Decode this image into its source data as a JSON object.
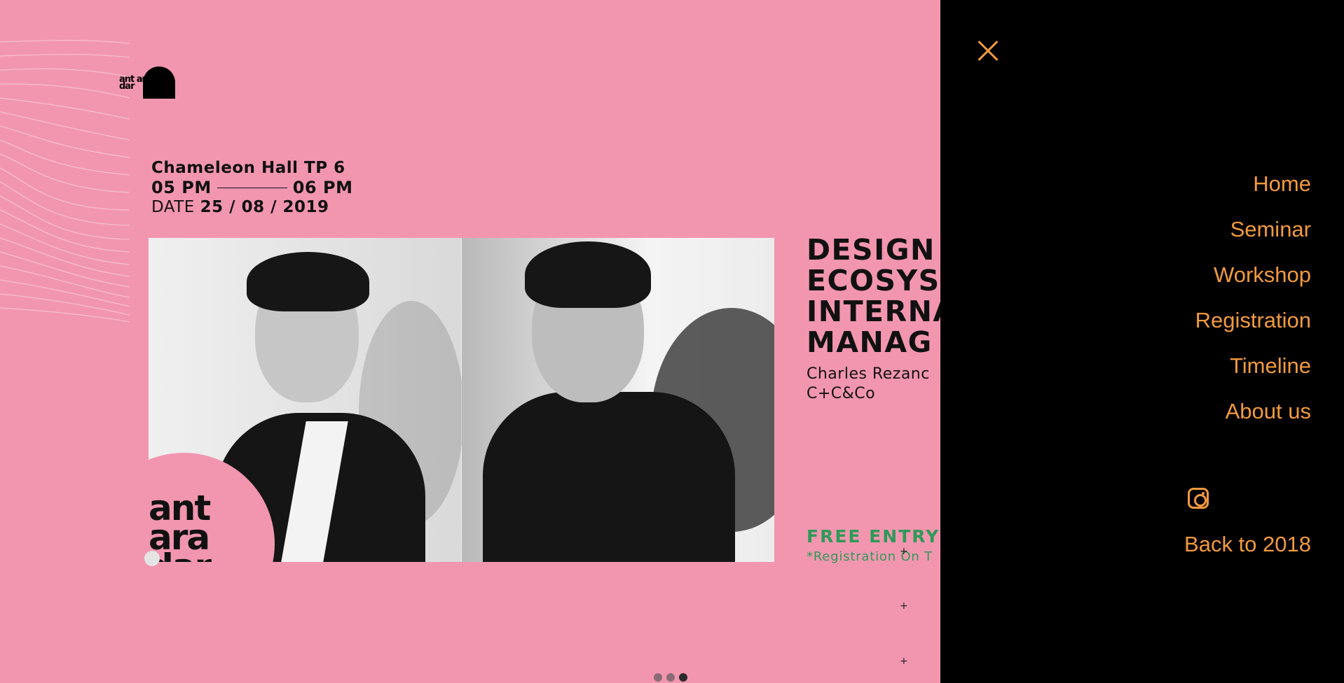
{
  "logo": {
    "text": "ant ara dar"
  },
  "event": {
    "venue": "Chameleon Hall TP 6",
    "start_time": "05 PM",
    "end_time": "06 PM",
    "date_label": "DATE",
    "date_value": "25 / 08 / 2019"
  },
  "seminar": {
    "title": "DESIGN\nECOSYS\nINTERNA\nMANAG",
    "speaker_name": "Charles Rezanc",
    "speaker_company": "C+C&Co",
    "free_entry": "FREE ENTRY",
    "registration_note": "*Registration On T"
  },
  "photo_badge": {
    "text": "ant\nara\ndar"
  },
  "menu": {
    "items": [
      {
        "label": "Home"
      },
      {
        "label": "Seminar"
      },
      {
        "label": "Workshop"
      },
      {
        "label": "Registration"
      },
      {
        "label": "Timeline"
      },
      {
        "label": "About us"
      }
    ],
    "back_link": "Back to 2018",
    "social_icon": "instagram-icon",
    "close_icon": "close-icon"
  },
  "pager": {
    "count": 3,
    "active_index": 2
  },
  "colors": {
    "background": "#f296b0",
    "menu_background": "#000000",
    "menu_accent": "#f29a3e",
    "free_entry": "#2e9a58",
    "text": "#111111"
  }
}
